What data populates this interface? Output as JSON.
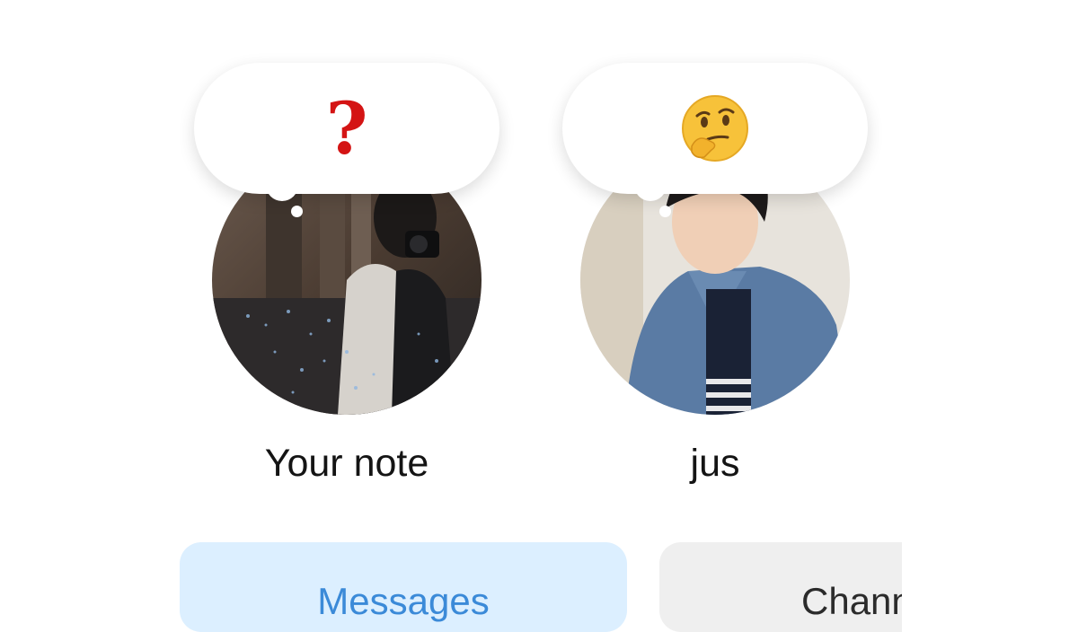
{
  "notes": [
    {
      "name": "Your note",
      "note": "?",
      "note_color": "#d41414"
    },
    {
      "name": "jus",
      "note_icon": "thinking-face-emoji"
    }
  ],
  "tabs": [
    {
      "label": "Messages",
      "active": true,
      "accent": "#3b8ad8"
    },
    {
      "label": "Chann",
      "active": false
    }
  ]
}
